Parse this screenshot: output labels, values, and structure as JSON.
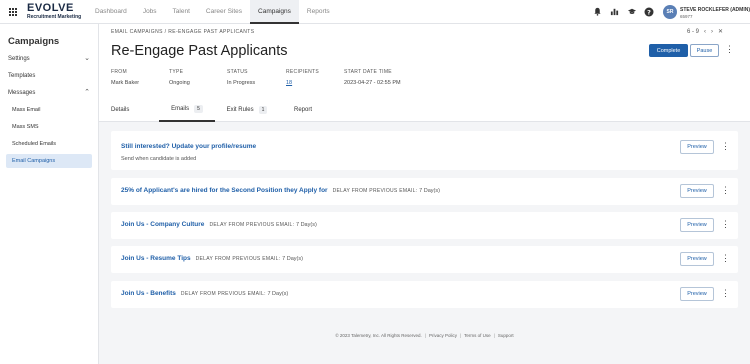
{
  "topbar": {
    "logo_main": "EVOLVE",
    "logo_sub": "Recruitment Marketing",
    "nav": [
      "Dashboard",
      "Jobs",
      "Talent",
      "Career Sites",
      "Campaigns",
      "Reports"
    ],
    "active_nav": "Campaigns",
    "icons": [
      "bell-icon",
      "chart-icon",
      "graduation-cap-icon",
      "help-icon"
    ],
    "user_initials": "SR",
    "user_name": "STEVE ROCKLEFER (ADMIN)",
    "user_id": "65977"
  },
  "sidebar": {
    "title": "Campaigns",
    "items": [
      {
        "label": "Settings",
        "chevron": "⌄"
      },
      {
        "label": "Templates",
        "chevron": ""
      },
      {
        "label": "Messages",
        "chevron": "⌃"
      }
    ],
    "subitems": [
      "Mass Email",
      "Mass SMS",
      "Scheduled Emails",
      "Email Campaigns"
    ],
    "active_subitem": "Email Campaigns"
  },
  "header": {
    "breadcrumb": "EMAIL CAMPAIGNS  /  RE-ENGAGE PAST APPLICANTS",
    "pager_text": "6 - 9",
    "title": "Re-Engage Past Applicants",
    "complete_label": "Complete",
    "pause_label": "Pause",
    "meta": [
      {
        "label": "FROM",
        "value": "Mark Baker"
      },
      {
        "label": "TYPE",
        "value": "Ongoing"
      },
      {
        "label": "STATUS",
        "value": "In Progress"
      },
      {
        "label": "RECIPIENTS",
        "value": "18"
      },
      {
        "label": "START DATE TIME",
        "value": "2023-04-27 - 02:55 PM"
      }
    ],
    "tabs": [
      {
        "label": "Details",
        "count": ""
      },
      {
        "label": "Emails",
        "count": "5"
      },
      {
        "label": "Exit Rules",
        "count": "1"
      },
      {
        "label": "Report",
        "count": ""
      }
    ],
    "active_tab": "Emails"
  },
  "emails": [
    {
      "title": "Still interested? Update your profile/resume",
      "delay_label": "",
      "delay_value": "",
      "note": "Send when candidate is added",
      "preview_label": "Preview"
    },
    {
      "title": "25% of Applicant's are hired for the Second Position they Apply for",
      "delay_label": "DELAY FROM PREVIOUS EMAIL:",
      "delay_value": "7 Day(s)",
      "note": "",
      "preview_label": "Preview"
    },
    {
      "title": "Join Us - Company Culture",
      "delay_label": "DELAY FROM PREVIOUS EMAIL:",
      "delay_value": "7 Day(s)",
      "note": "",
      "preview_label": "Preview"
    },
    {
      "title": "Join Us - Resume Tips",
      "delay_label": "DELAY FROM PREVIOUS EMAIL:",
      "delay_value": "7 Day(s)",
      "note": "",
      "preview_label": "Preview"
    },
    {
      "title": "Join Us - Benefits",
      "delay_label": "DELAY FROM PREVIOUS EMAIL:",
      "delay_value": "7 Day(s)",
      "note": "",
      "preview_label": "Preview"
    }
  ],
  "footer": {
    "copyright": "© 2023 Talemetry, Inc. All Rights Reserved.",
    "links": [
      "Privacy Policy",
      "Terms of Use",
      "Support"
    ]
  },
  "colors": {
    "accent": "#1f5fa8",
    "background": "#f4f5f7",
    "active_sidebar": "#dde8f6"
  }
}
